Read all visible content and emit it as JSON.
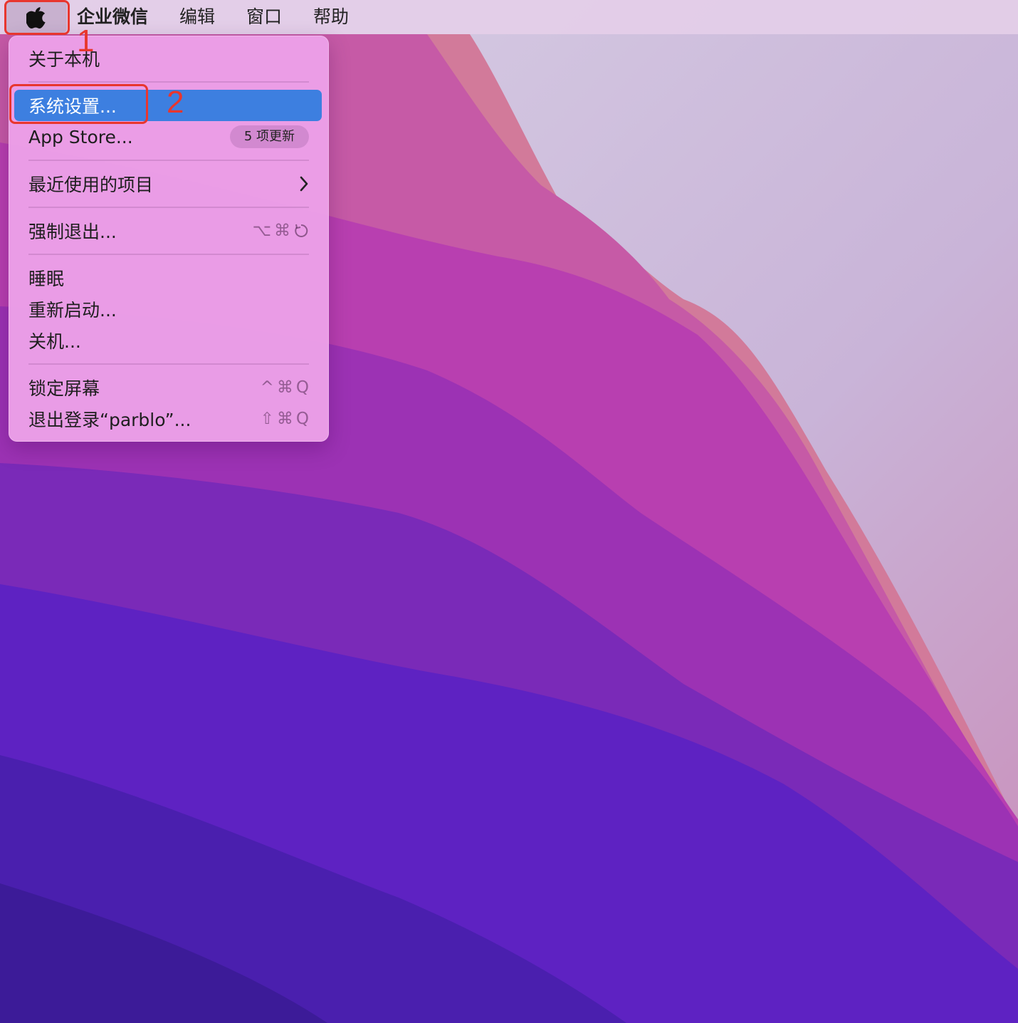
{
  "menubar": {
    "apple_icon": "apple-logo-icon",
    "items": [
      "企业微信",
      "编辑",
      "窗口",
      "帮助"
    ]
  },
  "apple_menu": {
    "about": "关于本机",
    "system_settings": "系统设置...",
    "app_store": "App Store...",
    "app_store_badge": "5 项更新",
    "recent_items": "最近使用的项目",
    "force_quit": "强制退出...",
    "force_quit_shortcut": [
      "⌥",
      "⌘"
    ],
    "sleep": "睡眠",
    "restart": "重新启动...",
    "shutdown": "关机...",
    "lock_screen": "锁定屏幕",
    "lock_screen_shortcut": [
      "^",
      "⌘",
      "Q"
    ],
    "logout": "退出登录“parblo”...",
    "logout_shortcut": [
      "⇧",
      "⌘",
      "Q"
    ]
  },
  "annotations": {
    "step1": "1",
    "step2": "2"
  },
  "colors": {
    "highlight": "#3d7fe0",
    "annotation": "#e8362e"
  }
}
